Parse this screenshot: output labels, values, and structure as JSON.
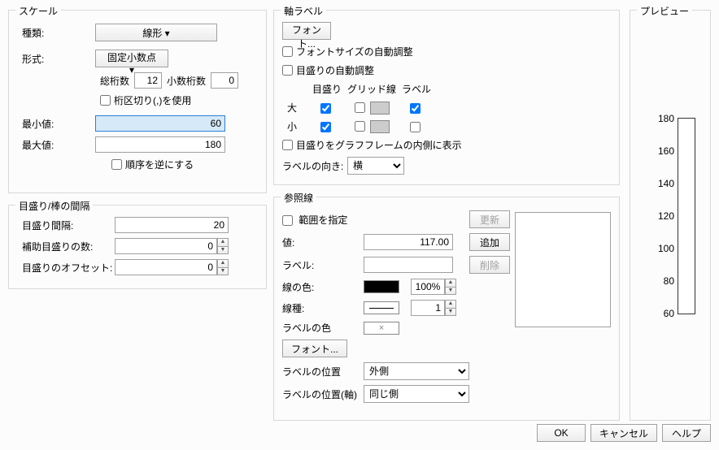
{
  "scale": {
    "legend": "スケール",
    "type_label": "種類:",
    "type_value": "線形 ▾",
    "format_label": "形式:",
    "format_value": "固定小数点 ▾",
    "total_digits_label": "総桁数",
    "total_digits_value": "12",
    "dec_digits_label": "小数桁数",
    "dec_digits_value": "0",
    "thousands_label": "桁区切り(,)を使用",
    "min_label": "最小値:",
    "min_value": "60",
    "max_label": "最大値:",
    "max_value": "180",
    "reverse_label": "順序を逆にする"
  },
  "ticks": {
    "legend": "目盛り/棒の間隔",
    "interval_label": "目盛り間隔:",
    "interval_value": "20",
    "minor_label": "補助目盛りの数:",
    "minor_value": "0",
    "offset_label": "目盛りのオフセット:",
    "offset_value": "0"
  },
  "axis_label": {
    "legend": "軸ラベル",
    "font_btn": "フォント...",
    "auto_font_label": "フォントサイズの自動調整",
    "auto_tick_label": "目盛りの自動調整",
    "col_tick": "目盛り",
    "col_grid": "グリッド線",
    "col_lbl": "ラベル",
    "row_major": "大",
    "row_minor": "小",
    "inside_label": "目盛りをグラフフレームの内側に表示",
    "orient_label": "ラベルの向き:",
    "orient_value": "横"
  },
  "reflines": {
    "legend": "参照線",
    "range_label": "範囲を指定",
    "update_btn": "更新",
    "value_label": "値:",
    "value_value": "117.00",
    "add_btn": "追加",
    "label_label": "ラベル:",
    "label_value": "",
    "delete_btn": "削除",
    "linecolor_label": "線の色:",
    "opacity_value": "100%",
    "linekind_label": "線種:",
    "linekind_value": "1",
    "labelcolor_label": "ラベルの色",
    "font_btn": "フォント...",
    "labelpos_label": "ラベルの位置",
    "labelpos_value": "外側",
    "labelpos_axis_label": "ラベルの位置(軸)",
    "labelpos_axis_value": "同じ側"
  },
  "preview": {
    "legend": "プレビュー",
    "tick180": "180",
    "tick160": "160",
    "tick140": "140",
    "tick120": "120",
    "tick100": "100",
    "tick80": "80",
    "tick60": "60"
  },
  "footer": {
    "ok": "OK",
    "cancel": "キャンセル",
    "help": "ヘルプ"
  }
}
